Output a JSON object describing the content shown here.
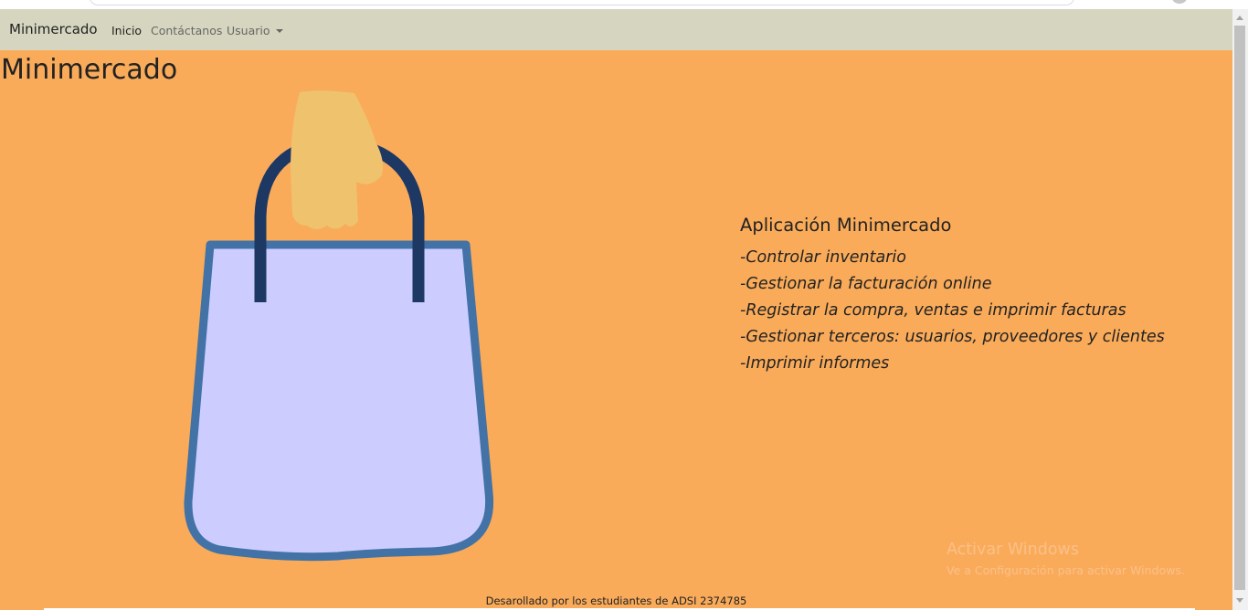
{
  "navbar": {
    "brand": "Minimercado",
    "links": [
      {
        "label": "Inicio",
        "active": true
      },
      {
        "label": "Contáctanos",
        "active": false
      }
    ],
    "dropdown": {
      "label": "Usuario"
    }
  },
  "main": {
    "title": "Minimercado",
    "info": {
      "heading": "Aplicación Minimercado",
      "features": [
        "-Controlar inventario",
        "-Gestionar la facturación online",
        "-Registrar la compra, ventas e imprimir facturas",
        "-Gestionar terceros: usuarios, proveedores y clientes",
        "-Imprimir informes"
      ]
    },
    "illustration": "shopping-bag-in-hand"
  },
  "footer": {
    "text": "Desarollado por los estudiantes de ADSI 2374785"
  },
  "watermark": {
    "title": "Activar Windows",
    "subtitle": "Ve a Configuración para activar Windows."
  },
  "colors": {
    "navbar_bg": "#d6d6c0",
    "page_bg": "#f9ab5a",
    "bag_fill": "#cccdfe",
    "bag_border": "#4372a6",
    "handle": "#1e3864",
    "hand": "#efc26e"
  }
}
